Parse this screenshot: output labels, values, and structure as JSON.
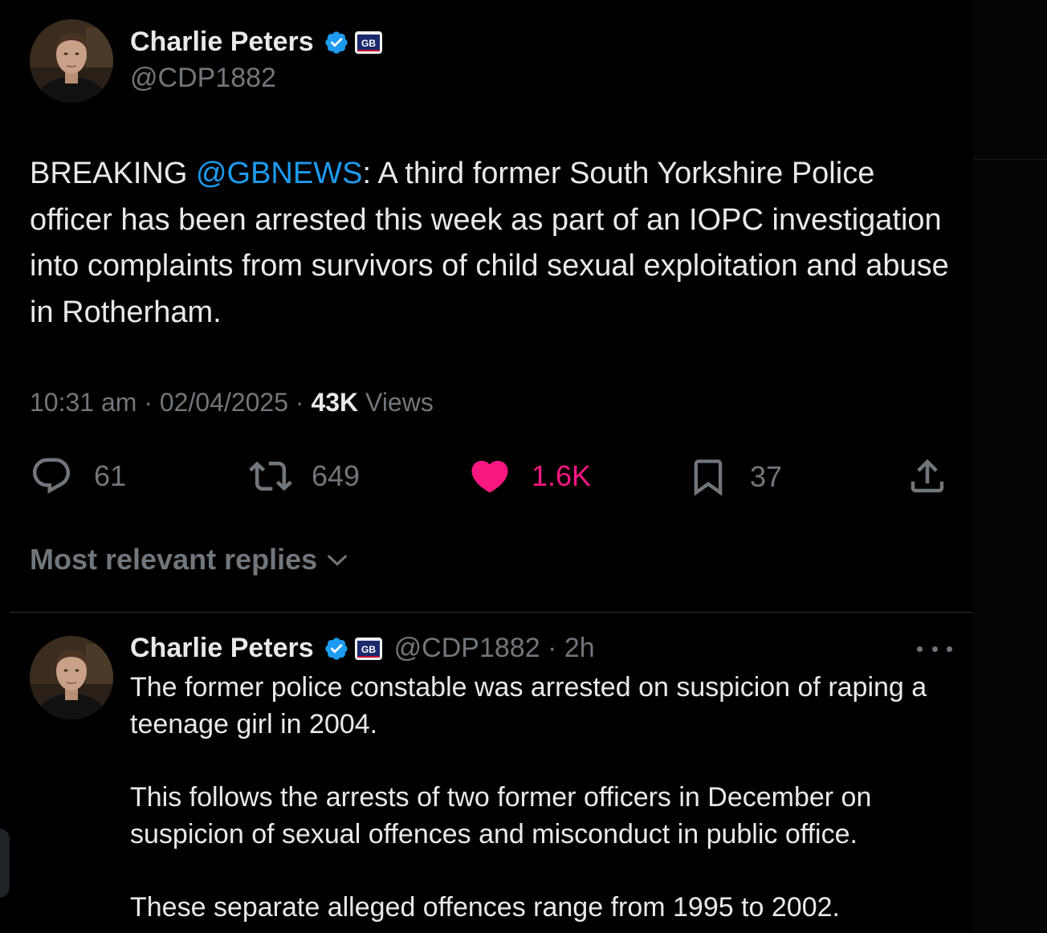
{
  "post": {
    "author_name": "Charlie Peters",
    "handle": "@CDP1882",
    "affiliation_badge_text": "GB",
    "text_prefix": "BREAKING ",
    "mention": "@GBNEWS",
    "text_body": ": A third former South Yorkshire Police officer has been arrested this week as part of an IOPC investigation into complaints from survivors of child sexual exploitation and abuse in Rotherham.",
    "time": "10:31 am",
    "date": "02/04/2025",
    "views_count": "43K",
    "views_label": "Views",
    "separator": " · ",
    "replies": "61",
    "reposts": "649",
    "likes": "1.6K",
    "bookmarks": "37"
  },
  "sort": {
    "label": "Most relevant replies"
  },
  "reply": {
    "author_name": "Charlie Peters",
    "handle_time": "@CDP1882 · 2h",
    "paragraph_1": "The former police constable was arrested on suspicion of raping a teenage girl in 2004.",
    "paragraph_2": "This follows the arrests of two former officers in December on suspicion of sexual offences and misconduct in public office.",
    "paragraph_3": "These separate alleged offences range from 1995 to 2002."
  },
  "colors": {
    "background": "#000000",
    "text": "#e7e9ea",
    "secondary": "#71767b",
    "link": "#1d9bf0",
    "like": "#f91880",
    "divider": "#2f3336"
  },
  "icons": [
    "verified-badge-icon",
    "gb-news-badge-icon",
    "reply-icon",
    "repost-icon",
    "like-icon",
    "bookmark-icon",
    "share-icon",
    "chevron-down-icon",
    "more-icon"
  ]
}
